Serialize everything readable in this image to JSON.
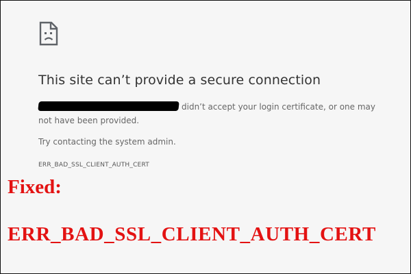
{
  "error_page": {
    "icon": "sad-page-icon",
    "title": "This site can’t provide a secure connection",
    "description_suffix": "didn’t accept your login certificate, or one may not have been provided.",
    "suggestion": "Try contacting the system admin.",
    "error_code": "ERR_BAD_SSL_CLIENT_AUTH_CERT"
  },
  "overlay": {
    "heading": "Fixed:",
    "code": "ERR_BAD_SSL_CLIENT_AUTH_CERT",
    "color": "#e31212"
  },
  "colors": {
    "background": "#f6f6f6",
    "title_text": "#333333",
    "body_text": "#666666"
  }
}
